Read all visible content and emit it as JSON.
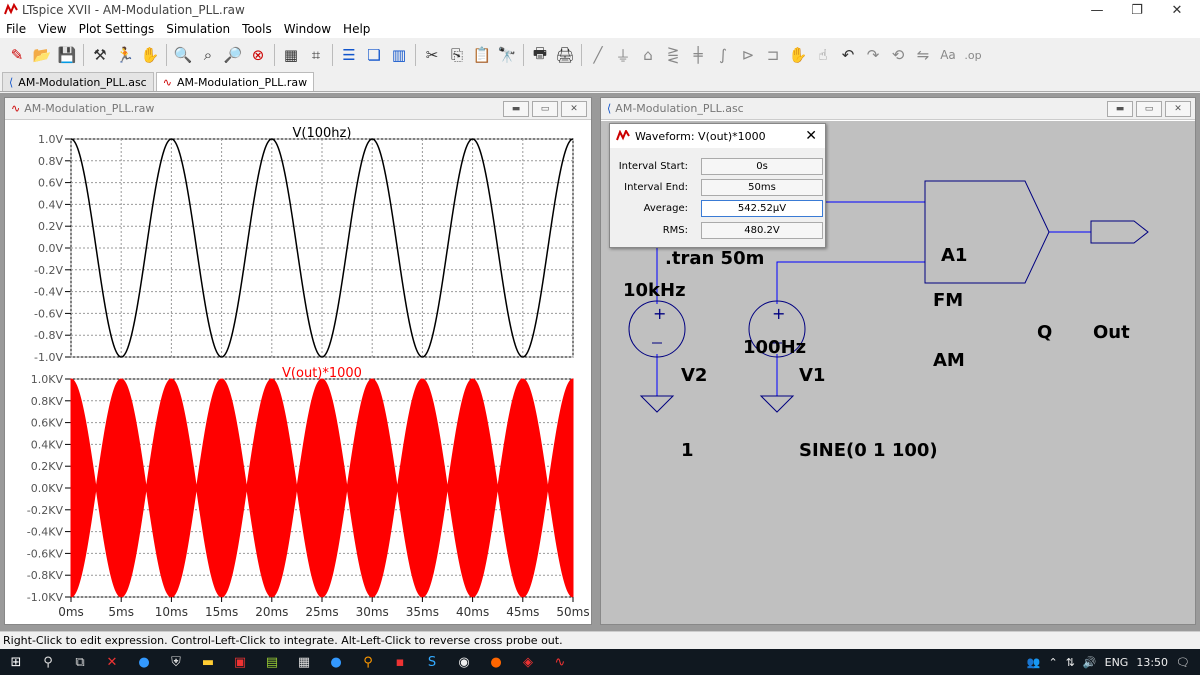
{
  "window": {
    "title": "LTspice XVII - AM-Modulation_PLL.raw",
    "controls": [
      "minimize",
      "restore",
      "close"
    ]
  },
  "menu": [
    "File",
    "View",
    "Plot Settings",
    "Simulation",
    "Tools",
    "Window",
    "Help"
  ],
  "toolbar_icons": [
    "new-schematic-icon",
    "open-icon",
    "save-icon",
    "control-panel-icon",
    "run-icon",
    "halt-icon",
    "zoom-in-icon",
    "zoom-full-icon",
    "zoom-out-icon",
    "cancel-zoom-icon",
    "autorange-icon",
    "marker-icon",
    "tile-horizontal-icon",
    "cascade-icon",
    "tile-vertical-icon",
    "cut-icon",
    "copy-icon",
    "paste-icon",
    "find-icon",
    "print-icon",
    "print-setup-icon",
    "wire-icon",
    "ground-icon",
    "label-net-icon",
    "resistor-icon",
    "capacitor-icon",
    "inductor-icon",
    "diode-icon",
    "component-icon",
    "move-icon",
    "drag-icon",
    "undo-icon",
    "redo-icon",
    "rotate-icon",
    "mirror-icon",
    "text-icon",
    "spice-directive-icon"
  ],
  "tabs": [
    {
      "label": "AM-Modulation_PLL.asc",
      "icon": "schematic-icon",
      "active": false
    },
    {
      "label": "AM-Modulation_PLL.raw",
      "icon": "waveform-icon",
      "active": true
    }
  ],
  "plot_window": {
    "title": "AM-Modulation_PLL.raw",
    "panes": [
      {
        "trace_label": "V(100hz)",
        "trace_color": "#000000",
        "y_ticks": [
          "1.0V",
          "0.8V",
          "0.6V",
          "0.4V",
          "0.2V",
          "0.0V",
          "-0.2V",
          "-0.4V",
          "-0.6V",
          "-0.8V",
          "-1.0V"
        ]
      },
      {
        "trace_label": "V(out)*1000",
        "trace_color": "#ff0000",
        "y_ticks": [
          "1.0KV",
          "0.8KV",
          "0.6KV",
          "0.4KV",
          "0.2KV",
          "0.0KV",
          "-0.2KV",
          "-0.4KV",
          "-0.6KV",
          "-0.8KV",
          "-1.0KV"
        ]
      }
    ],
    "x_ticks": [
      "0ms",
      "5ms",
      "10ms",
      "15ms",
      "20ms",
      "25ms",
      "30ms",
      "35ms",
      "40ms",
      "45ms",
      "50ms"
    ]
  },
  "chart_data": [
    {
      "type": "line",
      "series": [
        {
          "name": "V(100hz)",
          "frequency_hz": 100,
          "amplitude": 1.0
        }
      ],
      "xlabel": "",
      "ylabel": "",
      "xlim": [
        0,
        50
      ],
      "x_unit": "ms",
      "ylim": [
        -1.0,
        1.0
      ],
      "grid": true
    },
    {
      "type": "line",
      "series": [
        {
          "name": "V(out)*1000",
          "carrier_hz": 10000,
          "envelope_hz": 100,
          "amplitude": 1000
        }
      ],
      "xlabel": "",
      "ylabel": "",
      "xlim": [
        0,
        50
      ],
      "x_unit": "ms",
      "ylim": [
        -1000,
        1000
      ],
      "grid": true
    }
  ],
  "schematic_window": {
    "title": "AM-Modulation_PLL.asc",
    "labels": {
      "directive": ".tran 50m",
      "v2_value": "10kHz",
      "v1_value": "100Hz",
      "v2_name": "V2",
      "v1_name": "V1",
      "v2_param": "1",
      "v1_param": "SINE(0 1 100)",
      "block_name": "A1",
      "pin_fm": "FM",
      "pin_am": "AM",
      "pin_q": "Q",
      "out_label": "Out"
    },
    "colors": {
      "wire": "#0000ff",
      "component": "#000080",
      "background": "#c0c0c0"
    }
  },
  "dialog": {
    "title": "Waveform: V(out)*1000",
    "rows": [
      {
        "label": "Interval Start:",
        "value": "0s"
      },
      {
        "label": "Interval End:",
        "value": "50ms"
      },
      {
        "label": "Average:",
        "value": "542.52µV"
      },
      {
        "label": "RMS:",
        "value": "480.2V"
      }
    ]
  },
  "status_bar": "Right-Click to edit expression. Control-Left-Click to integrate. Alt-Left-Click to reverse cross probe out.",
  "taskbar": {
    "language": "ENG",
    "time": "13:50"
  }
}
